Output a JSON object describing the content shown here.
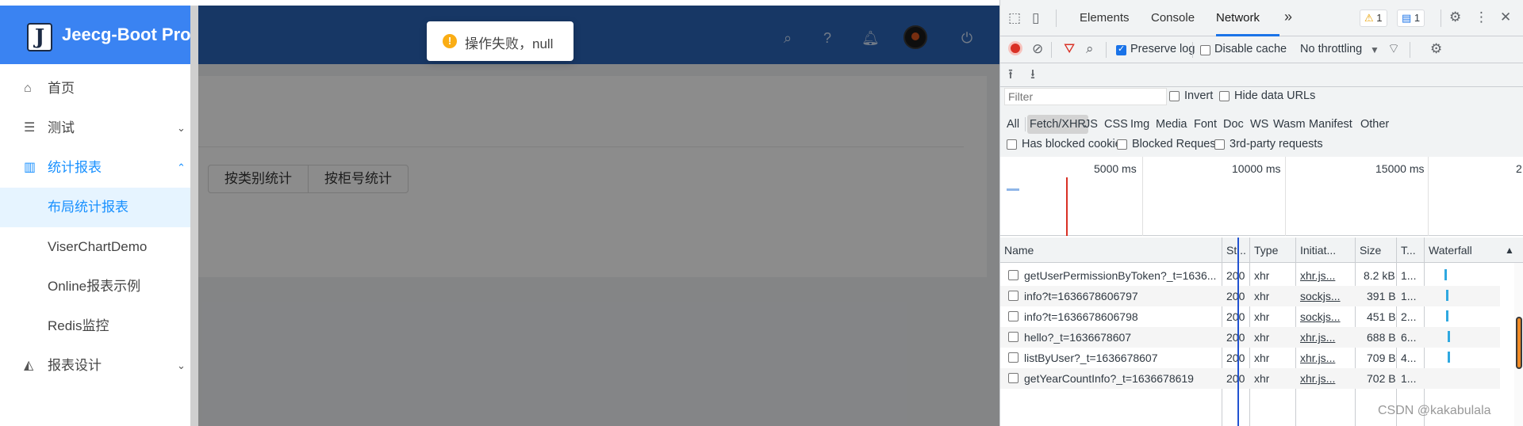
{
  "app": {
    "logo_letter": "J",
    "logo_text": "Jeecg-Boot Pro",
    "toast": {
      "text": "操作失败，null",
      "icon": "warning-icon"
    },
    "menu": [
      {
        "label": "首页",
        "icon": "home-icon"
      },
      {
        "label": "测试",
        "icon": "list-icon",
        "arrow": "chevron-down-icon"
      },
      {
        "label": "统计报表",
        "icon": "bar-chart-icon",
        "arrow": "chevron-up-icon",
        "state": "open"
      },
      {
        "label": "布局统计报表",
        "state": "active"
      },
      {
        "label": "ViserChartDemo"
      },
      {
        "label": "Online报表示例"
      },
      {
        "label": "Redis监控"
      },
      {
        "label": "报表设计",
        "icon": "area-chart-icon",
        "arrow": "chevron-down-icon"
      }
    ],
    "tabs": [
      "按类别统计",
      "按柜号统计"
    ],
    "header_icons": [
      "search-icon",
      "help-icon",
      "bell-icon",
      "avatar",
      "logout-icon"
    ]
  },
  "devtools": {
    "tabs": [
      "Elements",
      "Console",
      "Network"
    ],
    "active_tab": "Network",
    "more": "»",
    "warnings": "1",
    "messages": "1",
    "preserve_log": {
      "label": "Preserve log",
      "checked": true
    },
    "disable_cache": {
      "label": "Disable cache",
      "checked": false
    },
    "throttling": "No throttling",
    "filter_placeholder": "Filter",
    "invert": "Invert",
    "hide_data_urls": "Hide data URLs",
    "types": [
      "All",
      "Fetch/XHR",
      "JS",
      "CSS",
      "Img",
      "Media",
      "Font",
      "Doc",
      "WS",
      "Wasm",
      "Manifest",
      "Other"
    ],
    "active_type": "Fetch/XHR",
    "has_blocked_cookies": "Has blocked cookies",
    "blocked_requests": "Blocked Requests",
    "third_party": "3rd-party requests",
    "timeline_ticks": [
      "5000 ms",
      "10000 ms",
      "15000 ms",
      "2"
    ],
    "columns": [
      "Name",
      "St...",
      "Type",
      "Initiat...",
      "Size",
      "T...",
      "Waterfall"
    ],
    "sort_arrow": "▲",
    "requests": [
      {
        "name": "getUserPermissionByToken?_t=1636...",
        "status": "200",
        "type": "xhr",
        "initiator": "xhr.js...",
        "size": "8.2 kB",
        "time": "1..."
      },
      {
        "name": "info?t=1636678606797",
        "status": "200",
        "type": "xhr",
        "initiator": "sockjs...",
        "size": "391 B",
        "time": "1..."
      },
      {
        "name": "info?t=1636678606798",
        "status": "200",
        "type": "xhr",
        "initiator": "sockjs...",
        "size": "451 B",
        "time": "2..."
      },
      {
        "name": "hello?_t=1636678607",
        "status": "200",
        "type": "xhr",
        "initiator": "xhr.js...",
        "size": "688 B",
        "time": "6..."
      },
      {
        "name": "listByUser?_t=1636678607",
        "status": "200",
        "type": "xhr",
        "initiator": "xhr.js...",
        "size": "709 B",
        "time": "4..."
      },
      {
        "name": "getYearCountInfo?_t=1636678619",
        "status": "200",
        "type": "xhr",
        "initiator": "xhr.js...",
        "size": "702 B",
        "time": "1..."
      }
    ]
  },
  "watermark": "CSDN @kakabulala"
}
